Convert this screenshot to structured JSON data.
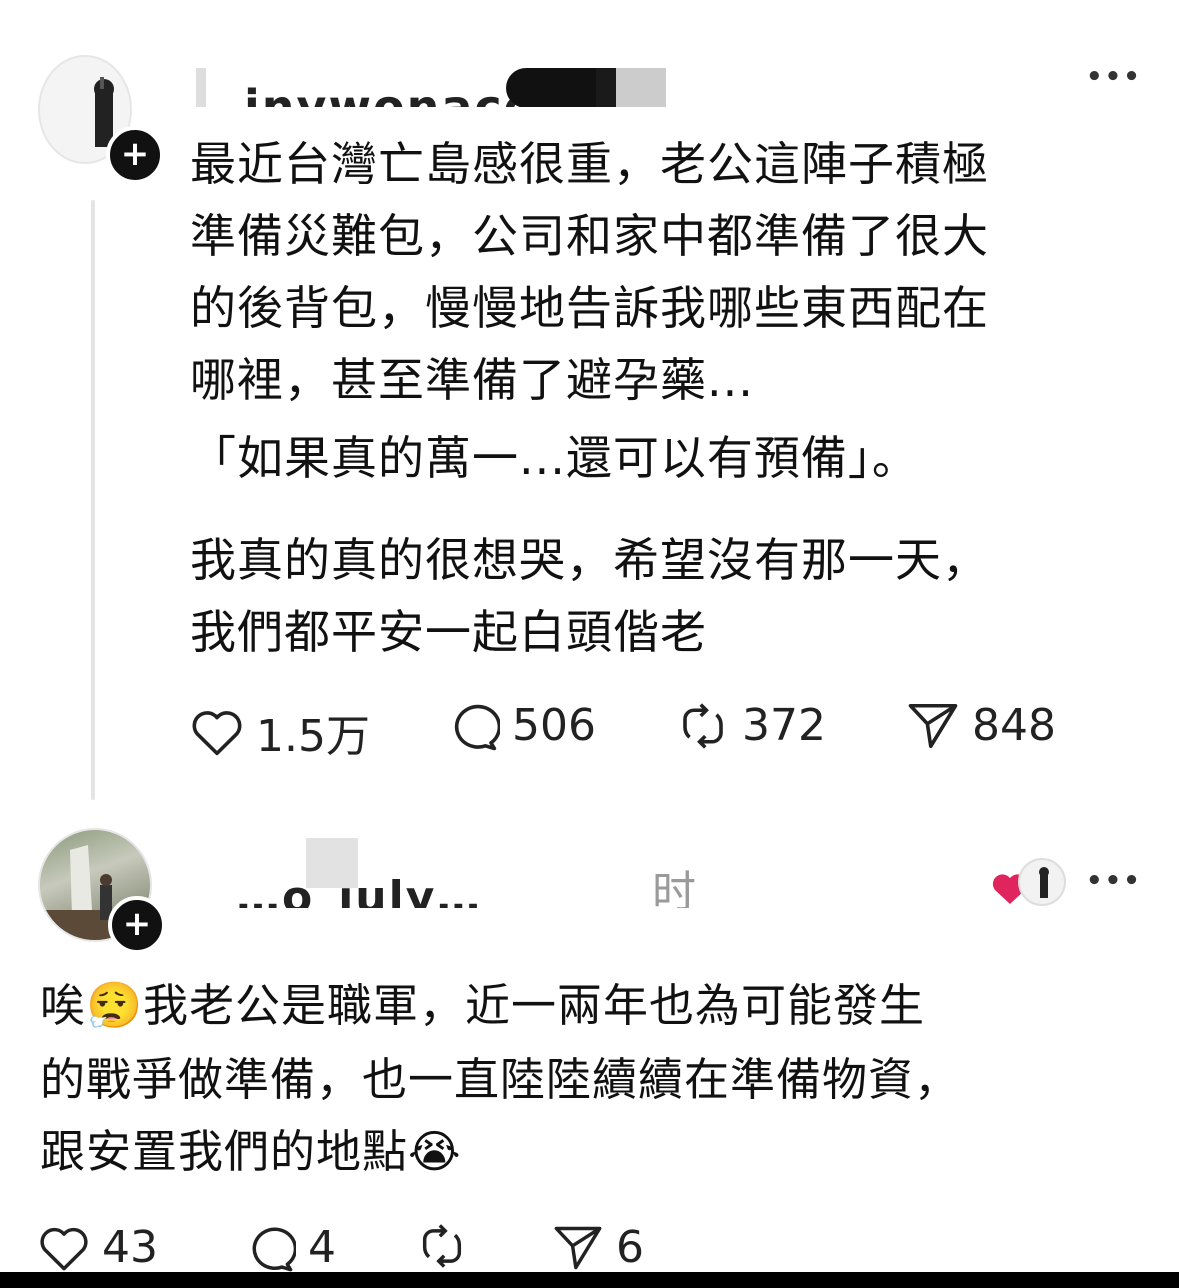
{
  "post": {
    "username": "…inywonaco…",
    "lines": [
      "最近台灣亡島感很重，老公這陣子積極",
      "準備災難包，公司和家中都準備了很大",
      "的後背包，慢慢地告訴我哪些東西配在",
      "哪裡，甚至準備了避孕藥...",
      "「如果真的萬一...還可以有預備」。",
      "我真的真的很想哭，希望沒有那一天，",
      "我們都平安一起白頭偕老"
    ],
    "likes": "1.5万",
    "comments": "506",
    "reposts": "372",
    "shares": "848"
  },
  "reply": {
    "username": "…o_july…",
    "time_fragment": "时",
    "lines": [
      "唉😮‍💨我老公是職軍，近一兩年也為可能發生",
      "的戰爭做準備，也一直陸陸續續在準備物資，",
      "跟安置我們的地點😭"
    ],
    "likes": "43",
    "comments": "4",
    "shares": "6"
  },
  "colors": {
    "like_heart": "#e0245e"
  }
}
